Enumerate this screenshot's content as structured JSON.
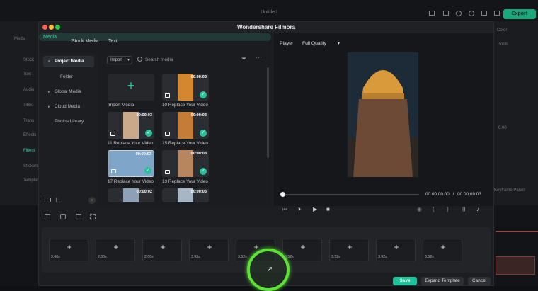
{
  "background": {
    "window_title": "Untitled",
    "export_label": "Export",
    "rail_items": [
      "Media",
      "Stock",
      "Text",
      "Audio",
      "Titles",
      "Trans",
      "Effects",
      "Filters",
      "Stickers",
      "Templates"
    ],
    "right_items": [
      "Color",
      "Tools",
      "Keyframe Panel"
    ],
    "right_values": [
      "0.00"
    ]
  },
  "modal": {
    "title": "Wondershare Filmora",
    "tabs": [
      "Media",
      "Stock Media",
      "Text"
    ],
    "library": [
      {
        "label": "Project Media",
        "active": true,
        "expandable": true
      },
      {
        "label": "Folder",
        "active": false,
        "expandable": false
      },
      {
        "label": "Global Media",
        "active": false,
        "expandable": true
      },
      {
        "label": "Cloud Media",
        "active": false,
        "expandable": true
      },
      {
        "label": "Photos Library",
        "active": false,
        "expandable": false
      }
    ],
    "import_label": "Import",
    "search_placeholder": "Search media",
    "import_media_label": "Import Media",
    "media_items": [
      {
        "label": "10 Replace Your Video",
        "duration": "00:00:03",
        "checked": true
      },
      {
        "label": "11 Replace Your Video",
        "duration": "00:00:03",
        "checked": true
      },
      {
        "label": "15 Replace Your Video",
        "duration": "00:00:03",
        "checked": true
      },
      {
        "label": "17 Replace Your Video",
        "duration": "00:00:03",
        "checked": true
      },
      {
        "label": "13 Replace Your Video",
        "duration": "00:00:03",
        "checked": true
      },
      {
        "label": "",
        "duration": "00:00:02",
        "checked": false
      },
      {
        "label": "",
        "duration": "00:00:03",
        "checked": false
      }
    ],
    "player": {
      "label": "Player",
      "quality": "Full Quality",
      "current_time": "00:00:00:00",
      "separator": "/",
      "total_time": "00:00:09:03",
      "progress": 0
    },
    "slots": [
      "3.60s",
      "2.00s",
      "2.00s",
      "3.52s",
      "3.52s",
      "3.52s",
      "3.52s",
      "3.52s",
      "3.52s"
    ],
    "buttons": {
      "save": "Save",
      "expand": "Expand Template",
      "cancel": "Cancel"
    },
    "colors": {
      "accent": "#1fc29b",
      "click_ring": "#5de336"
    }
  }
}
